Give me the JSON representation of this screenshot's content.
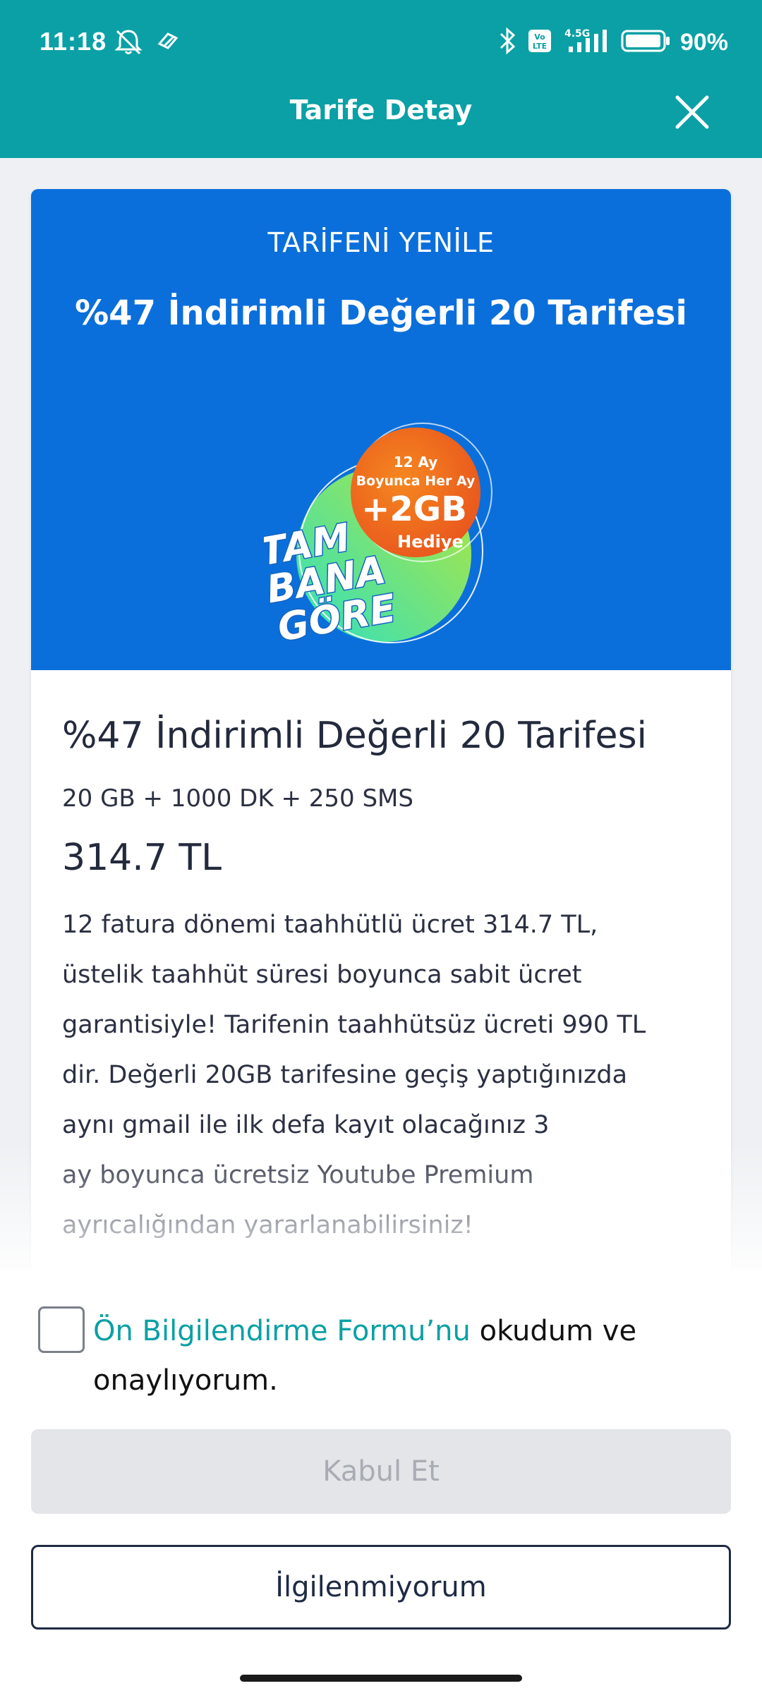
{
  "status_bar": {
    "time": "11:18",
    "battery": "90%",
    "network": "4.5G",
    "volte": "Vo LTE",
    "icons": [
      "mute-icon",
      "swirl-icon",
      "bluetooth-icon",
      "volte-icon",
      "signal-icon",
      "battery-icon"
    ]
  },
  "header": {
    "title": "Tarife Detay",
    "close_icon": "close-icon"
  },
  "banner": {
    "kicker": "TARİFENİ YENİLE",
    "title": "%47 İndirimli Değerli 20 Tarifesi",
    "promo": {
      "line1": "12 Ay",
      "line2": "Boyunca Her Ay",
      "big": "+2GB",
      "line3": "Hediye",
      "brand1": "TAM",
      "brand2": "BANA",
      "brand3": "GÖRE"
    },
    "colors": {
      "background": "#0b6fdb",
      "orange": "#f06a1c",
      "green": "#36d6a0"
    }
  },
  "product": {
    "title": "%47 İndirimli Değerli 20 Tarifesi",
    "package": "20 GB + 1000 DK + 250 SMS",
    "price": "314.7 TL",
    "description_lines": [
      "12 fatura dönemi taahhütlü ücret 314.7 TL,",
      "üstelik taahhüt süresi boyunca sabit ücret",
      "garantisiyle! Tarifenin taahhütsüz ücreti 990 TL",
      "dir. Değerli 20GB tarifesine geçiş yaptığınızda",
      "aynı gmail ile ilk defa kayıt olacağınız 3",
      "ay boyunca ücretsiz Youtube Premium",
      "ayrıcalığından yararlanabilirsiniz!"
    ]
  },
  "consent": {
    "link_text": "Ön Bilgilendirme Formu’nu",
    "text_after": " okudum ve",
    "text_line2": "onaylıyorum.",
    "checked": false
  },
  "buttons": {
    "accept": "Kabul Et",
    "decline": "İlgilenmiyorum"
  },
  "theme": {
    "header": "#0aa0a5",
    "link": "#0aa0a5",
    "disabled_bg": "#e3e5e8",
    "outline": "#1f2a44"
  }
}
